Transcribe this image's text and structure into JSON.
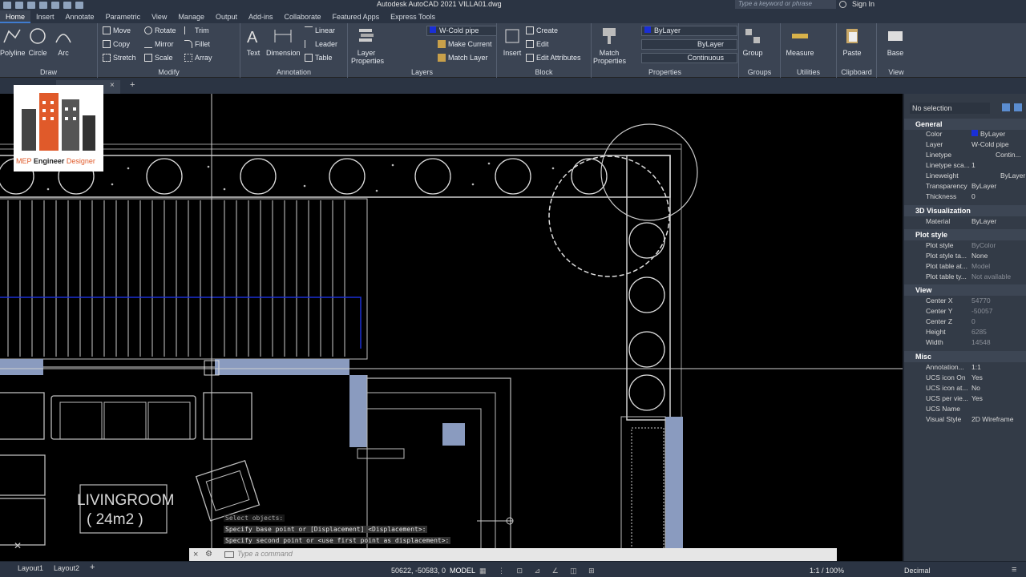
{
  "app": {
    "title": "Autodesk AutoCAD 2021   VILLA01.dwg",
    "search_placeholder": "Type a keyword or phrase",
    "signin_label": "Sign In"
  },
  "tabs": [
    {
      "label": "Home"
    },
    {
      "label": "Insert"
    },
    {
      "label": "Annotate"
    },
    {
      "label": "Parametric"
    },
    {
      "label": "View"
    },
    {
      "label": "Manage"
    },
    {
      "label": "Output"
    },
    {
      "label": "Add-ins"
    },
    {
      "label": "Collaborate"
    },
    {
      "label": "Featured Apps"
    },
    {
      "label": "Express Tools"
    }
  ],
  "ribbon": {
    "draw": {
      "title": "Draw",
      "polyline": "Polyline",
      "circle": "Circle",
      "arc": "Arc"
    },
    "modify": {
      "title": "Modify",
      "move": "Move",
      "rotate": "Rotate",
      "trim": "Trim",
      "copy": "Copy",
      "mirror": "Mirror",
      "fillet": "Fillet",
      "stretch": "Stretch",
      "scale": "Scale",
      "array": "Array"
    },
    "annotation": {
      "title": "Annotation",
      "text": "Text",
      "dimension": "Dimension",
      "linear": "Linear",
      "leader": "Leader",
      "table": "Table"
    },
    "layers": {
      "title": "Layers",
      "layer_properties": "Layer Properties",
      "current_layer": "W-Cold pipe",
      "make_current": "Make Current",
      "match_layer": "Match Layer"
    },
    "block": {
      "title": "Block",
      "insert": "Insert",
      "create": "Create",
      "edit": "Edit",
      "edit_attributes": "Edit Attributes"
    },
    "properties": {
      "title": "Properties",
      "match_properties": "Match Properties",
      "color": "ByLayer",
      "lineweight": "ByLayer",
      "linetype": "Continuous"
    },
    "groups": {
      "title": "Groups",
      "group": "Group"
    },
    "utilities": {
      "title": "Utilities",
      "measure": "Measure"
    },
    "clipboard": {
      "title": "Clipboard",
      "paste": "Paste"
    },
    "view": {
      "title": "View",
      "base": "Base"
    }
  },
  "drawing": {
    "room_name": "LIVINGROOM",
    "room_area": "( 24m2 )",
    "logo_line1": "MEP",
    "logo_line2": "Engineer",
    "logo_line3": "Designer"
  },
  "properties_palette": {
    "selection": "No selection",
    "sections": {
      "general": "General",
      "visualization": "3D Visualization",
      "plot_style": "Plot style",
      "view": "View",
      "misc": "Misc"
    },
    "general": [
      {
        "key": "Color",
        "value": "ByLayer"
      },
      {
        "key": "Layer",
        "value": "W-Cold pipe"
      },
      {
        "key": "Linetype",
        "value": "Contin..."
      },
      {
        "key": "Linetype sca...",
        "value": "1"
      },
      {
        "key": "Lineweight",
        "value": "ByLayer"
      },
      {
        "key": "Transparency",
        "value": "ByLayer"
      },
      {
        "key": "Thickness",
        "value": "0"
      }
    ],
    "visualization": [
      {
        "key": "Material",
        "value": "ByLayer"
      }
    ],
    "plot_style": [
      {
        "key": "Plot style",
        "value": "ByColor"
      },
      {
        "key": "Plot style ta...",
        "value": "None"
      },
      {
        "key": "Plot table at...",
        "value": "Model"
      },
      {
        "key": "Plot table ty...",
        "value": "Not available"
      }
    ],
    "view": [
      {
        "key": "Center X",
        "value": "54770"
      },
      {
        "key": "Center Y",
        "value": "-50057"
      },
      {
        "key": "Center Z",
        "value": "0"
      },
      {
        "key": "Height",
        "value": "6285"
      },
      {
        "key": "Width",
        "value": "14548"
      }
    ],
    "misc": [
      {
        "key": "Annotation...",
        "value": "1:1"
      },
      {
        "key": "UCS icon On",
        "value": "Yes"
      },
      {
        "key": "UCS icon at...",
        "value": "No"
      },
      {
        "key": "UCS per vie...",
        "value": "Yes"
      },
      {
        "key": "UCS Name",
        "value": ""
      },
      {
        "key": "Visual Style",
        "value": "2D Wireframe"
      }
    ]
  },
  "command": {
    "history": [
      "Select objects:",
      "Specify base point or [Displacement] <Displacement>:",
      "Specify second point or <use first point as displacement>:"
    ],
    "placeholder": "Type a command"
  },
  "status": {
    "layout1": "Layout1",
    "layout2": "Layout2",
    "coords": "50622, -50583, 0",
    "space": "MODEL",
    "scale": "1:1 / 100%",
    "units": "Decimal"
  },
  "colors": {
    "accent": "#3f7cd0",
    "pipe": "#1a2fd6",
    "fill": "#8a9bbf"
  }
}
